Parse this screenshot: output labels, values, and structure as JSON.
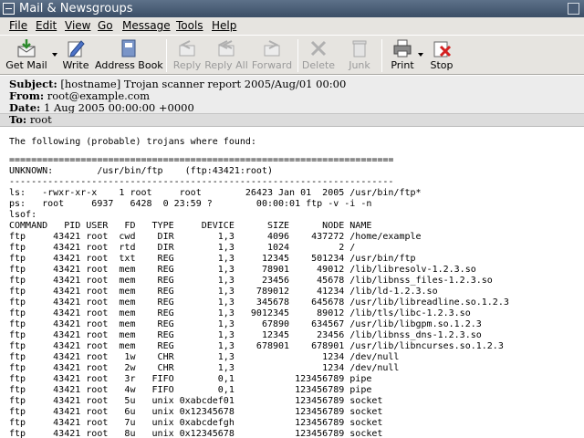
{
  "window": {
    "title": "Mail & Newsgroups"
  },
  "menu": [
    "File",
    "Edit",
    "View",
    "Go",
    "Message",
    "Tools",
    "Help"
  ],
  "toolbar": {
    "get_mail": "Get Mail",
    "write": "Write",
    "address_book": "Address Book",
    "reply": "Reply",
    "reply_all": "Reply All",
    "forward": "Forward",
    "delete": "Delete",
    "junk": "Junk",
    "print": "Print",
    "stop": "Stop"
  },
  "headers": {
    "subject_label": "Subject:",
    "subject": "[hostname] Trojan scanner report 2005/Aug/01 00:00",
    "from_label": "From:",
    "from": "root@example.com",
    "date_label": "Date:",
    "date": "1 Aug 2005 00:00:00 +0000",
    "to_label": "To:",
    "to": "root"
  },
  "body_lines": [
    "The following (probable) trojans where found:",
    "",
    "======================================================================",
    "UNKNOWN:        /usr/bin/ftp    (ftp:43421:root)",
    "----------------------------------------------------------------------",
    "ls:   -rwxr-xr-x    1 root     root        26423 Jan 01  2005 /usr/bin/ftp*",
    "ps:   root     6937   6428  0 23:59 ?        00:00:01 ftp -v -i -n",
    "lsof:",
    "COMMAND   PID USER   FD   TYPE     DEVICE      SIZE      NODE NAME",
    "ftp     43421 root  cwd    DIR        1,3      4096    437272 /home/example",
    "ftp     43421 root  rtd    DIR        1,3      1024         2 /",
    "ftp     43421 root  txt    REG        1,3     12345    501234 /usr/bin/ftp",
    "ftp     43421 root  mem    REG        1,3     78901     49012 /lib/libresolv-1.2.3.so",
    "ftp     43421 root  mem    REG        1,3     23456     45678 /lib/libnss_files-1.2.3.so",
    "ftp     43421 root  mem    REG        1,3    789012     41234 /lib/ld-1.2.3.so",
    "ftp     43421 root  mem    REG        1,3    345678    645678 /usr/lib/libreadline.so.1.2.3",
    "ftp     43421 root  mem    REG        1,3   9012345     89012 /lib/tls/libc-1.2.3.so",
    "ftp     43421 root  mem    REG        1,3     67890    634567 /usr/lib/libgpm.so.1.2.3",
    "ftp     43421 root  mem    REG        1,3     12345     23456 /lib/libnss_dns-1.2.3.so",
    "ftp     43421 root  mem    REG        1,3    678901    678901 /usr/lib/libncurses.so.1.2.3",
    "ftp     43421 root   1w    CHR        1,3                1234 /dev/null",
    "ftp     43421 root   2w    CHR        1,3                1234 /dev/null",
    "ftp     43421 root   3r   FIFO        0,1           123456789 pipe",
    "ftp     43421 root   4w   FIFO        0,1           123456789 pipe",
    "ftp     43421 root   5u   unix 0xabcdef01           123456789 socket",
    "ftp     43421 root   6u   unix 0x12345678           123456789 socket",
    "ftp     43421 root   7u   unix 0xabcdefgh           123456789 socket",
    "ftp     43421 root   8u   unix 0x12345678           123456789 socket"
  ]
}
